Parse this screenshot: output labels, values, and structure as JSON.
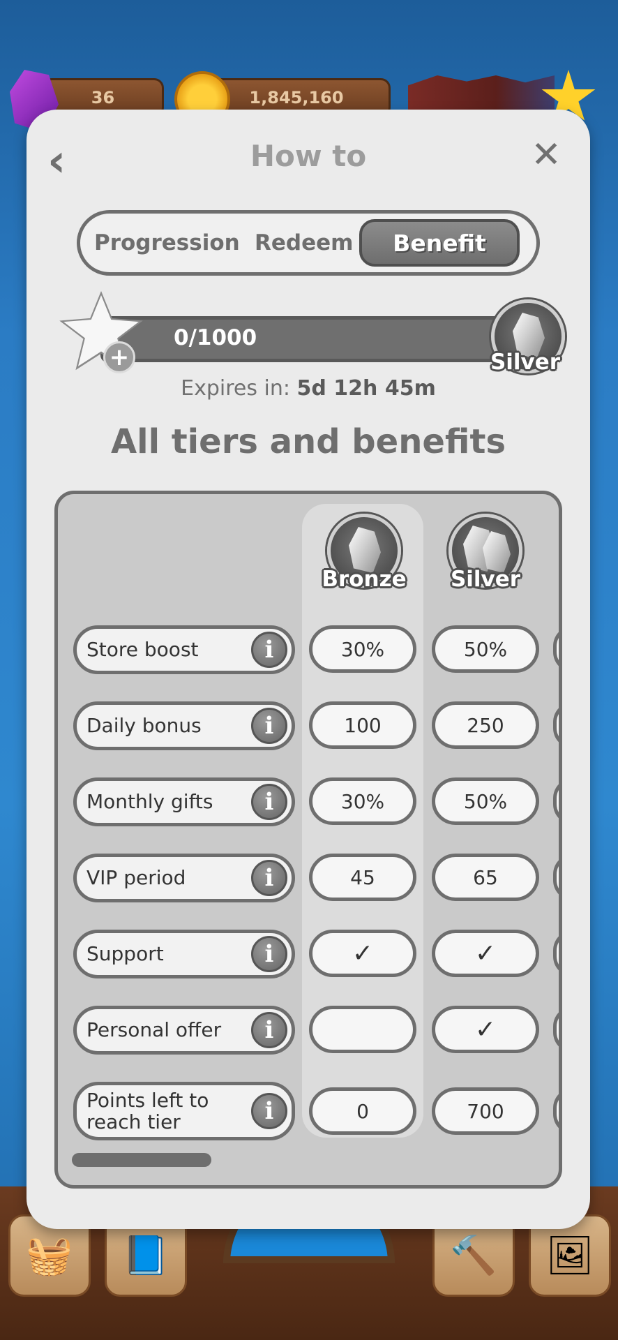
{
  "background": {
    "gems_count": "36",
    "coins_count": "1,845,160"
  },
  "modal": {
    "title": "How to",
    "back_icon": "chevron-left-icon",
    "close_icon": "close-icon"
  },
  "tabs": [
    {
      "label": "Progression",
      "active": false
    },
    {
      "label": "Redeem",
      "active": false
    },
    {
      "label": "Benefit",
      "active": true
    }
  ],
  "progress": {
    "text": "0/1000",
    "current": 0,
    "max": 1000,
    "fraction": 0,
    "next_tier": "Silver",
    "expires_label": "Expires in:",
    "expires_value": "5d 12h 45m"
  },
  "tiers_heading": "All tiers and benefits",
  "tiers": [
    {
      "name": "Bronze"
    },
    {
      "name": "Silver"
    }
  ],
  "rows": [
    {
      "label": "Store boost",
      "values": [
        "30%",
        "50%"
      ]
    },
    {
      "label": "Daily bonus",
      "values": [
        "100",
        "250"
      ]
    },
    {
      "label": "Monthly gifts",
      "values": [
        "30%",
        "50%"
      ]
    },
    {
      "label": "VIP period",
      "values": [
        "45",
        "65"
      ]
    },
    {
      "label": "Support",
      "values": [
        "✓",
        "✓"
      ]
    },
    {
      "label": "Personal offer",
      "values": [
        "",
        "✓"
      ]
    },
    {
      "label": "Points left to reach tier",
      "values": [
        "0",
        "700"
      ]
    }
  ],
  "colors": {
    "modal_bg": "#ebebeb",
    "accent_gray": "#6e6e6e",
    "panel_bg": "#cacaca"
  }
}
